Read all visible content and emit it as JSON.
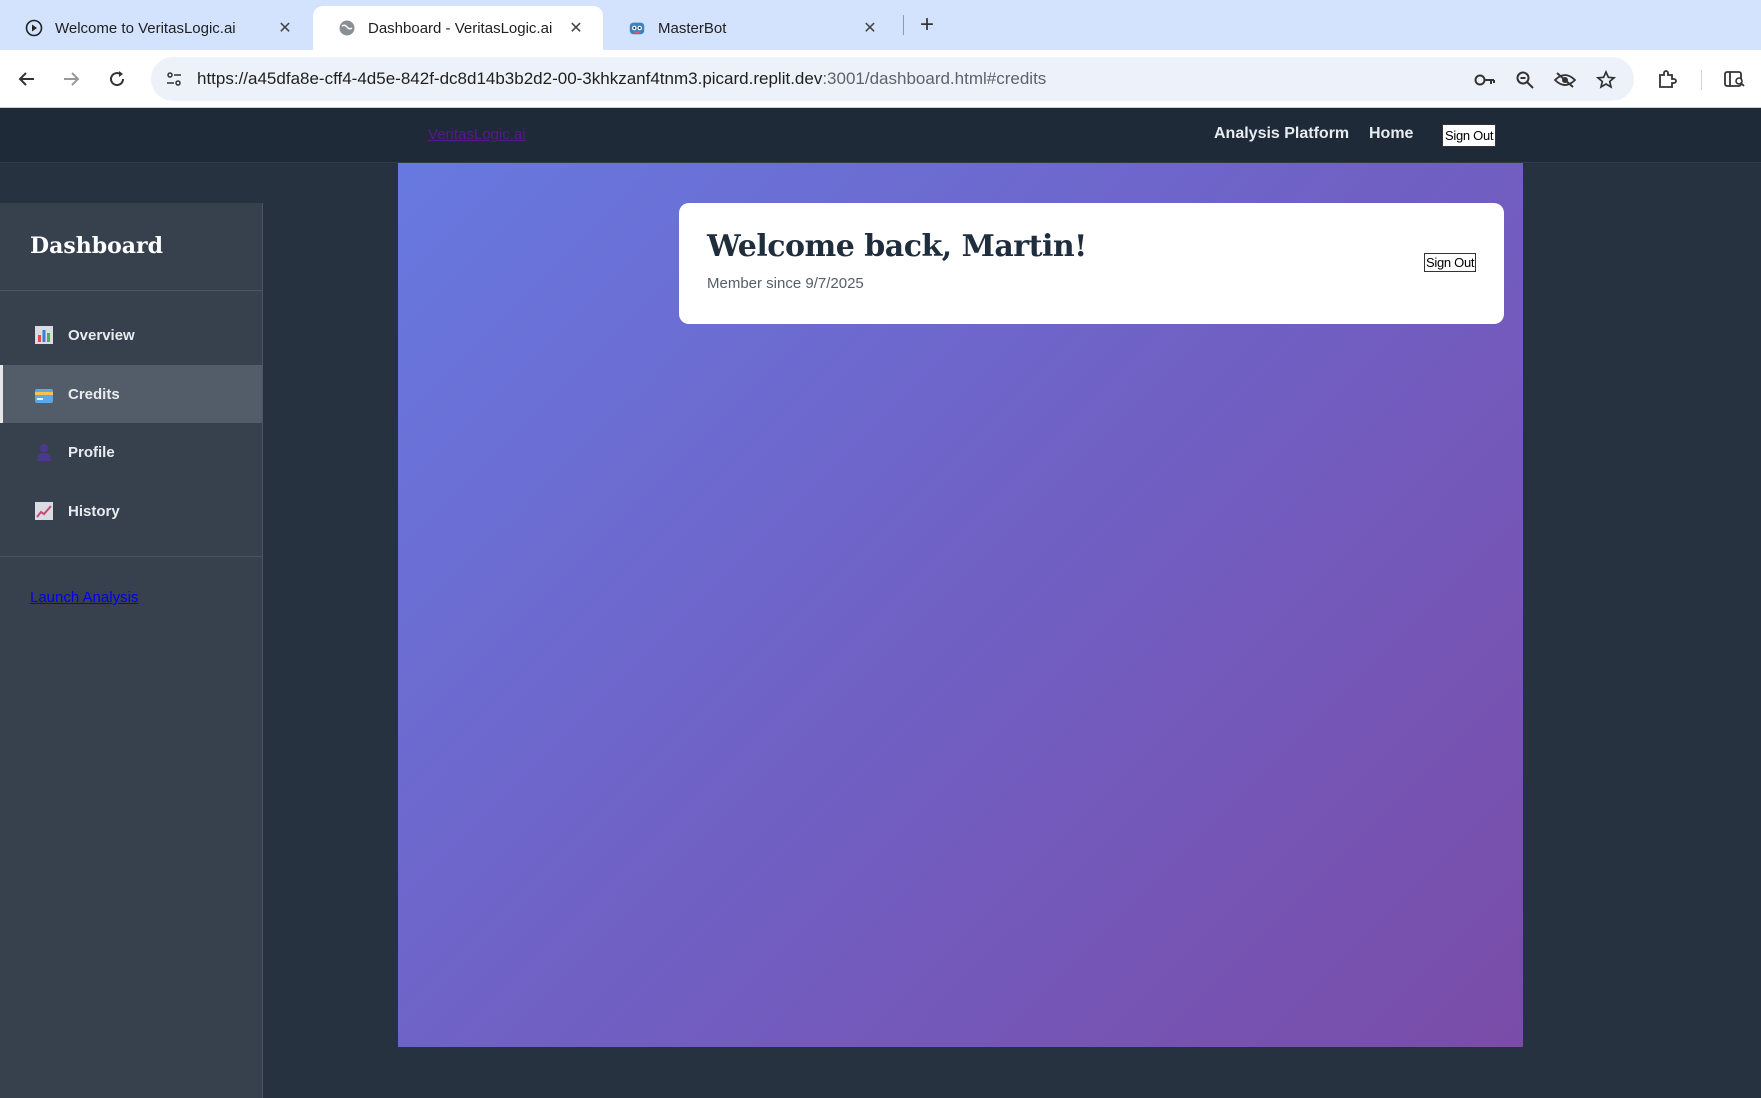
{
  "browser": {
    "tabs": [
      {
        "title": "Welcome to VeritasLogic.ai",
        "icon": "circle-play-icon",
        "active": false
      },
      {
        "title": "Dashboard - VeritasLogic.ai",
        "icon": "globe-icon",
        "active": true
      },
      {
        "title": "MasterBot",
        "icon": "robot-icon",
        "active": false
      }
    ],
    "url_main": "https://a45dfa8e-cff4-4d5e-842f-dc8d14b3b2d2-00-3khkzanf4tnm3.picard.replit.dev",
    "url_rest": ":3001/dashboard.html#credits"
  },
  "header": {
    "brand": "VeritasLogic.ai",
    "nav": [
      "Analysis Platform",
      "Home"
    ],
    "signout_label": "Sign Out"
  },
  "sidebar": {
    "title": "Dashboard",
    "items": [
      {
        "label": "Overview",
        "icon": "bar-chart-icon",
        "active": false
      },
      {
        "label": "Credits",
        "icon": "credit-card-icon",
        "active": true
      },
      {
        "label": "Profile",
        "icon": "user-icon",
        "active": false
      },
      {
        "label": "History",
        "icon": "trend-chart-icon",
        "active": false
      }
    ],
    "launch_link": "Launch Analysis"
  },
  "main": {
    "welcome_title": "Welcome back, Martin!",
    "member_since": "Member since 9/7/2025",
    "signout_label": "Sign Out"
  },
  "colors": {
    "header_bg": "#1f2a38",
    "sidebar_bg": "#36414d",
    "gradient_start": "#6779e0",
    "gradient_end": "#7a4ca8"
  }
}
